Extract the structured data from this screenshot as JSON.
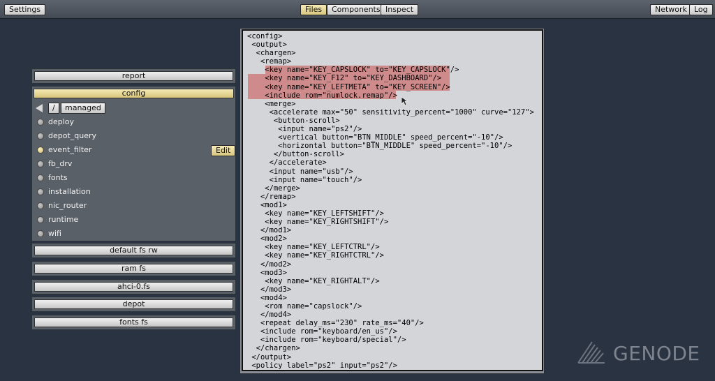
{
  "topbar": {
    "settings": "Settings",
    "files": "Files",
    "components": "Components",
    "inspect": "Inspect",
    "network": "Network",
    "log": "Log"
  },
  "left": {
    "report": "report",
    "config": "config",
    "breadcrumb": {
      "root": "/",
      "folder": "managed"
    },
    "items": [
      {
        "label": "deploy",
        "active": false
      },
      {
        "label": "depot_query",
        "active": false
      },
      {
        "label": "event_filter",
        "active": true
      },
      {
        "label": "fb_drv",
        "active": false
      },
      {
        "label": "fonts",
        "active": false
      },
      {
        "label": "installation",
        "active": false
      },
      {
        "label": "nic_router",
        "active": false
      },
      {
        "label": "runtime",
        "active": false
      },
      {
        "label": "wifi",
        "active": false
      }
    ],
    "edit": "Edit",
    "fs_buttons": [
      "default fs rw",
      "ram fs",
      "ahci-0.fs",
      "depot",
      "fonts fs"
    ]
  },
  "editor": {
    "lines": [
      "<config>",
      " <output>",
      "  <chargen>",
      "   <remap>",
      "    <key name=\"KEY_CAPSLOCK\" to=\"KEY_CAPSLOCK\"/>",
      "    <key name=\"KEY_F12\" to=\"KEY_DASHBOARD\"/>",
      "    <key name=\"KEY_LEFTMETA\" to=\"KEY_SCREEN\"/>",
      "    <include rom=\"numlock.remap\"/>",
      "    <merge>",
      "     <accelerate max=\"50\" sensitivity_percent=\"1000\" curve=\"127\">",
      "      <button-scroll>",
      "       <input name=\"ps2\"/>",
      "       <vertical button=\"BTN_MIDDLE\" speed_percent=\"-10\"/>",
      "       <horizontal button=\"BTN_MIDDLE\" speed_percent=\"-10\"/>",
      "      </button-scroll>",
      "     </accelerate>",
      "     <input name=\"usb\"/>",
      "     <input name=\"touch\"/>",
      "    </merge>",
      "   </remap>",
      "   <mod1>",
      "    <key name=\"KEY_LEFTSHIFT\"/>",
      "    <key name=\"KEY_RIGHTSHIFT\"/>",
      "   </mod1>",
      "   <mod2>",
      "    <key name=\"KEY_LEFTCTRL\"/>",
      "    <key name=\"KEY_RIGHTCTRL\"/>",
      "   </mod2>",
      "   <mod3>",
      "    <key name=\"KEY_RIGHTALT\"/>",
      "   </mod3>",
      "   <mod4>",
      "    <rom name=\"capslock\"/>",
      "   </mod4>",
      "   <repeat delay_ms=\"230\" rate_ms=\"40\"/>",
      "   <include rom=\"keyboard/en_us\"/>",
      "   <include rom=\"keyboard/special\"/>",
      "  </chargen>",
      " </output>",
      " <policy label=\"ps2\" input=\"ps2\"/>"
    ],
    "selection_color": "#cf8b8b"
  },
  "logo": {
    "text": "GENODE"
  }
}
